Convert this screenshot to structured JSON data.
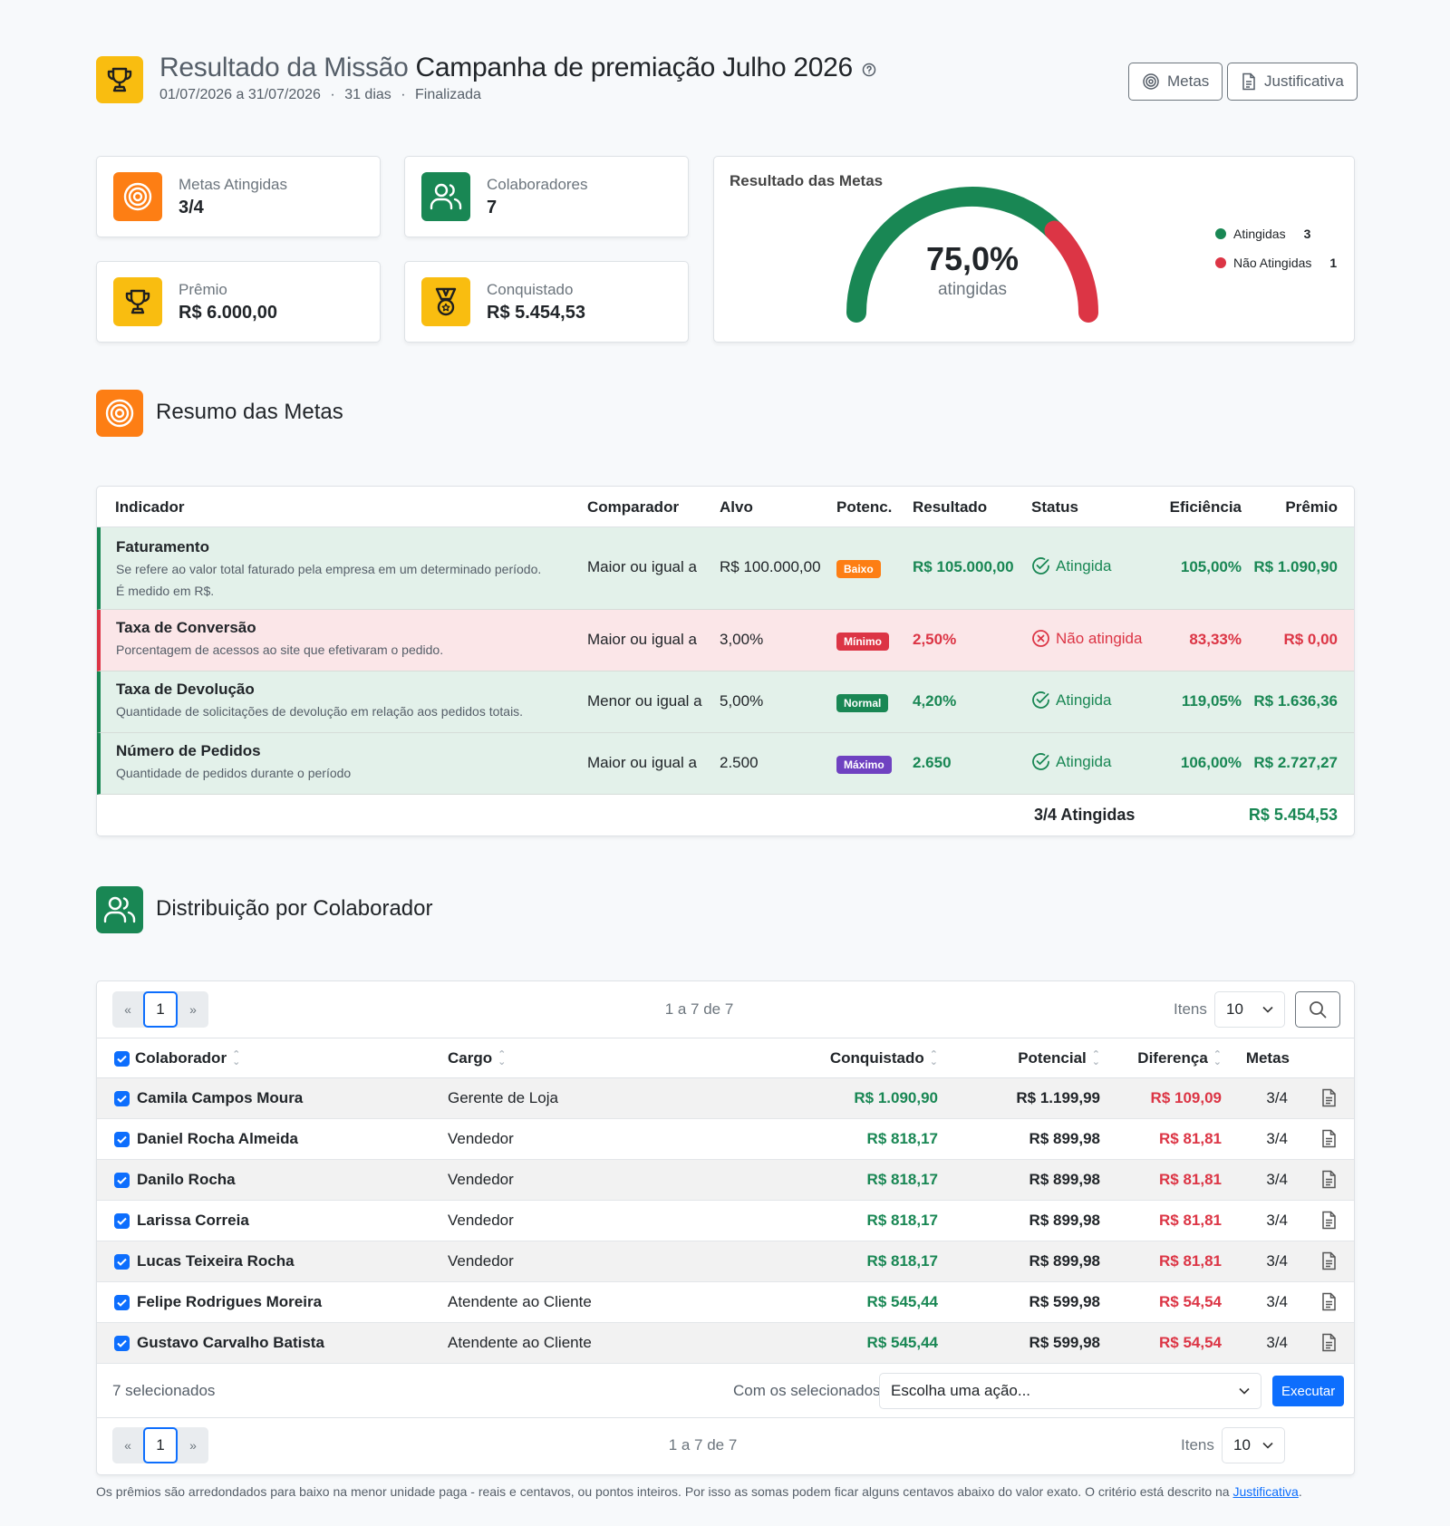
{
  "header": {
    "title_lead": "Resultado da Missão",
    "title_name": "Campanha de premiação Julho 2026",
    "period": "01/07/2026 a 31/07/2026",
    "days": "31 dias",
    "status": "Finalizada",
    "separator": "·",
    "btn_metas": "Metas",
    "btn_justificativa": "Justificativa"
  },
  "kpis": {
    "metas_label": "Metas Atingidas",
    "metas_value": "3/4",
    "colab_label": "Colaboradores",
    "colab_value": "7",
    "premio_label": "Prêmio",
    "premio_value": "R$ 6.000,00",
    "conq_label": "Conquistado",
    "conq_value": "R$ 5.454,53"
  },
  "gauge": {
    "title": "Resultado das Metas",
    "percent": "75,0%",
    "caption": "atingidas",
    "fraction": 0.75,
    "color_ok": "#198754",
    "color_bad": "#dc3545",
    "legend_ok_label": "Atingidas",
    "legend_ok_value": "3",
    "legend_bad_label": "Não Atingidas",
    "legend_bad_value": "1"
  },
  "goals": {
    "section_title": "Resumo das Metas",
    "headers": {
      "indicador": "Indicador",
      "comparador": "Comparador",
      "alvo": "Alvo",
      "potenc": "Potenc.",
      "resultado": "Resultado",
      "status": "Status",
      "eficiencia": "Eficiência",
      "premio": "Prêmio"
    },
    "rows": [
      {
        "name": "Faturamento",
        "desc1": "Se refere ao valor total faturado pela empresa em um determinado período.",
        "desc2": "É medido em R$.",
        "comparador": "Maior ou igual a",
        "alvo": "R$ 100.000,00",
        "potenc": "Baixo",
        "potenc_color": "#fd7e14",
        "resultado": "R$ 105.000,00",
        "status": "Atingida",
        "eficiencia": "105,00%",
        "premio": "R$ 1.090,90"
      },
      {
        "name": "Taxa de Conversão",
        "desc1": "Porcentagem de acessos ao site que efetivaram o pedido.",
        "comparador": "Maior ou igual a",
        "alvo": "3,00%",
        "potenc": "Mínimo",
        "potenc_color": "#dc3545",
        "resultado": "2,50%",
        "status": "Não atingida",
        "eficiencia": "83,33%",
        "premio": "R$ 0,00"
      },
      {
        "name": "Taxa de Devolução",
        "desc1": "Quantidade de solicitações de devolução em relação aos pedidos totais.",
        "comparador": "Menor ou igual a",
        "alvo": "5,00%",
        "potenc": "Normal",
        "potenc_color": "#198754",
        "resultado": "4,20%",
        "status": "Atingida",
        "eficiencia": "119,05%",
        "premio": "R$ 1.636,36"
      },
      {
        "name": "Número de Pedidos",
        "desc1": "Quantidade de pedidos durante o período",
        "comparador": "Maior ou igual a",
        "alvo": "2.500",
        "potenc": "Máximo",
        "potenc_color": "#6f42c1",
        "resultado": "2.650",
        "status": "Atingida",
        "eficiencia": "106,00%",
        "premio": "R$ 2.727,27"
      }
    ],
    "footer_status": "3/4 Atingidas",
    "footer_total": "R$ 5.454,53"
  },
  "collab": {
    "section_title": "Distribuição por Colaborador",
    "pager_prev": "«",
    "pager_next": "»",
    "page": "1",
    "range": "1 a 7 de 7",
    "itens_label": "Itens",
    "itens_value": "10",
    "headers": {
      "colaborador": "Colaborador",
      "cargo": "Cargo",
      "conquistado": "Conquistado",
      "potencial": "Potencial",
      "diferenca": "Diferença",
      "metas": "Metas"
    },
    "rows": [
      {
        "name": "Camila Campos Moura",
        "cargo": "Gerente de Loja",
        "conquistado": "R$ 1.090,90",
        "potencial": "R$ 1.199,99",
        "diferenca": "R$ 109,09",
        "metas": "3/4"
      },
      {
        "name": "Daniel Rocha Almeida",
        "cargo": "Vendedor",
        "conquistado": "R$ 818,17",
        "potencial": "R$ 899,98",
        "diferenca": "R$ 81,81",
        "metas": "3/4"
      },
      {
        "name": "Danilo Rocha",
        "cargo": "Vendedor",
        "conquistado": "R$ 818,17",
        "potencial": "R$ 899,98",
        "diferenca": "R$ 81,81",
        "metas": "3/4"
      },
      {
        "name": "Larissa Correia",
        "cargo": "Vendedor",
        "conquistado": "R$ 818,17",
        "potencial": "R$ 899,98",
        "diferenca": "R$ 81,81",
        "metas": "3/4"
      },
      {
        "name": "Lucas Teixeira Rocha",
        "cargo": "Vendedor",
        "conquistado": "R$ 818,17",
        "potencial": "R$ 899,98",
        "diferenca": "R$ 81,81",
        "metas": "3/4"
      },
      {
        "name": "Felipe Rodrigues Moreira",
        "cargo": "Atendente ao Cliente",
        "conquistado": "R$ 545,44",
        "potencial": "R$ 599,98",
        "diferenca": "R$ 54,54",
        "metas": "3/4"
      },
      {
        "name": "Gustavo Carvalho Batista",
        "cargo": "Atendente ao Cliente",
        "conquistado": "R$ 545,44",
        "potencial": "R$ 599,98",
        "diferenca": "R$ 54,54",
        "metas": "3/4"
      }
    ],
    "selected_text": "7 selecionados",
    "with_selected_label": "Com os selecionados:",
    "action_placeholder": "Escolha uma ação...",
    "execute_label": "Executar"
  },
  "footnote": {
    "text": "Os prêmios são arredondados para baixo na menor unidade paga - reais e centavos, ou pontos inteiros. Por isso as somas podem ficar alguns centavos abaixo do valor exato. O critério está descrito na",
    "link": "Justificativa",
    "end": "."
  }
}
